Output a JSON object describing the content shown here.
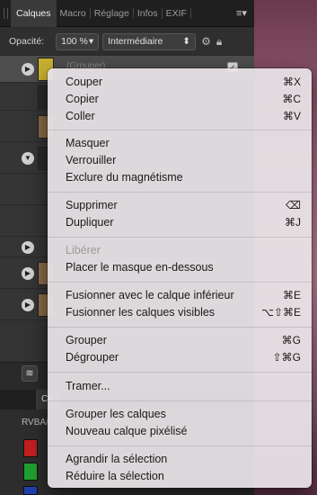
{
  "panel": {
    "tabs": [
      "Calques",
      "Macro",
      "Réglage",
      "Infos",
      "EXIF"
    ],
    "opacity_label": "Opacité:",
    "opacity_value": "100 %",
    "blend_mode": "Intermédiaire",
    "first_layer_name": "(Grouper)",
    "bottom_tab": "Ca",
    "channels_label": "RVBA/"
  },
  "menu": {
    "couper": {
      "label": "Couper",
      "shortcut": "⌘X"
    },
    "copier": {
      "label": "Copier",
      "shortcut": "⌘C"
    },
    "coller": {
      "label": "Coller",
      "shortcut": "⌘V"
    },
    "masquer": {
      "label": "Masquer"
    },
    "verrouiller": {
      "label": "Verrouiller"
    },
    "exclure": {
      "label": "Exclure du magnétisme"
    },
    "supprimer": {
      "label": "Supprimer",
      "shortcut": "⌫"
    },
    "dupliquer": {
      "label": "Dupliquer",
      "shortcut": "⌘J"
    },
    "liberer": {
      "label": "Libérer"
    },
    "placer_masque": {
      "label": "Placer le masque en-dessous"
    },
    "fusionner_inf": {
      "label": "Fusionner avec le calque inférieur",
      "shortcut": "⌘E"
    },
    "fusionner_vis": {
      "label": "Fusionner les calques visibles",
      "shortcut": "⌥⇧⌘E"
    },
    "grouper": {
      "label": "Grouper",
      "shortcut": "⌘G"
    },
    "degrouper": {
      "label": "Dégrouper",
      "shortcut": "⇧⌘G"
    },
    "tramer": {
      "label": "Tramer..."
    },
    "grouper_calques": {
      "label": "Grouper les calques"
    },
    "nouveau_pixelise": {
      "label": "Nouveau calque pixélisé"
    },
    "agrandir": {
      "label": "Agrandir la sélection"
    },
    "reduire": {
      "label": "Réduire la sélection"
    }
  },
  "colors": {
    "menu_bg": "#e8e2e6",
    "panel_bg": "#2b2b2b",
    "disabled_text": "#9a9a9a"
  }
}
